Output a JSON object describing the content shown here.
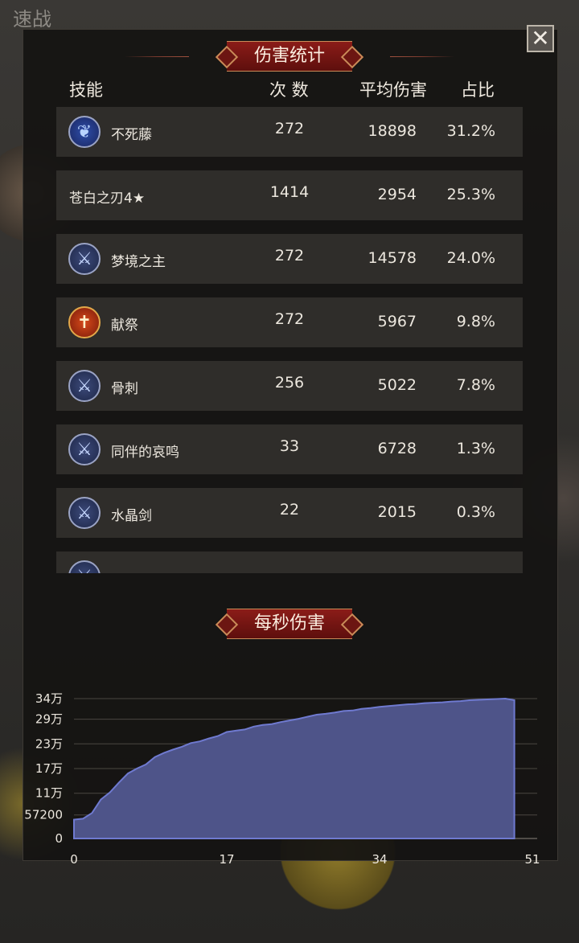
{
  "background_title": "速战",
  "damage_stats": {
    "title": "伤害统计",
    "headers": {
      "skill": "技能",
      "count": "次 数",
      "avg": "平均伤害",
      "ratio": "占比"
    },
    "rows": [
      {
        "icon": "vine-skill-icon",
        "name": "不死藤",
        "count": "272",
        "avg": "18898",
        "ratio": "31.2%"
      },
      {
        "icon": "",
        "name": "苍白之刃4★",
        "count": "1414",
        "avg": "2954",
        "ratio": "25.3%"
      },
      {
        "icon": "sword-skill-icon",
        "name": "梦境之主",
        "count": "272",
        "avg": "14578",
        "ratio": "24.0%"
      },
      {
        "icon": "sacrifice-skill-icon",
        "name": "献祭",
        "count": "272",
        "avg": "5967",
        "ratio": "9.8%"
      },
      {
        "icon": "sword-skill-icon",
        "name": "骨刺",
        "count": "256",
        "avg": "5022",
        "ratio": "7.8%"
      },
      {
        "icon": "sword-skill-icon",
        "name": "同伴的哀鸣",
        "count": "33",
        "avg": "6728",
        "ratio": "1.3%"
      },
      {
        "icon": "sword-skill-icon",
        "name": "水晶剑",
        "count": "22",
        "avg": "2015",
        "ratio": "0.3%"
      }
    ]
  },
  "dps": {
    "title": "每秒伤害"
  },
  "close_label": "✕",
  "colors": {
    "ribbon": "#7a1512",
    "area_fill": "#4e5489",
    "area_line": "#6f7ad0"
  },
  "chart_data": {
    "type": "area",
    "title": "每秒伤害",
    "xlabel": "",
    "ylabel": "",
    "x_ticks": [
      "0",
      "17",
      "34",
      "51"
    ],
    "y_ticks": [
      {
        "value": 0,
        "label": "0"
      },
      {
        "value": 57200,
        "label": "57200"
      },
      {
        "value": 110000,
        "label": "11万"
      },
      {
        "value": 170000,
        "label": "17万"
      },
      {
        "value": 230000,
        "label": "23万"
      },
      {
        "value": 290000,
        "label": "29万"
      },
      {
        "value": 340000,
        "label": "34万"
      }
    ],
    "xlim": [
      0,
      51
    ],
    "ylim": [
      0,
      340000
    ],
    "x": [
      0,
      1,
      2,
      3,
      4,
      5,
      6,
      7,
      8,
      9,
      10,
      11,
      12,
      13,
      14,
      15,
      16,
      17,
      18,
      19,
      20,
      21,
      22,
      23,
      24,
      25,
      26,
      27,
      28,
      29,
      30,
      31,
      32,
      33,
      34,
      35,
      36,
      37,
      38,
      39,
      40,
      41,
      42,
      43,
      44,
      45,
      46,
      47,
      48,
      49
    ],
    "values": [
      46000,
      48000,
      62000,
      95000,
      112000,
      136000,
      158000,
      170000,
      180000,
      198000,
      208000,
      216000,
      223000,
      232000,
      236000,
      243000,
      249000,
      259000,
      262000,
      265000,
      272000,
      276000,
      278000,
      283000,
      287000,
      291000,
      296000,
      301000,
      303000,
      306000,
      310000,
      311000,
      315000,
      317000,
      320000,
      322000,
      324000,
      326000,
      327000,
      329000,
      330000,
      331000,
      333000,
      334000,
      336000,
      337000,
      338000,
      339000,
      340000,
      336000
    ],
    "grid": true
  }
}
